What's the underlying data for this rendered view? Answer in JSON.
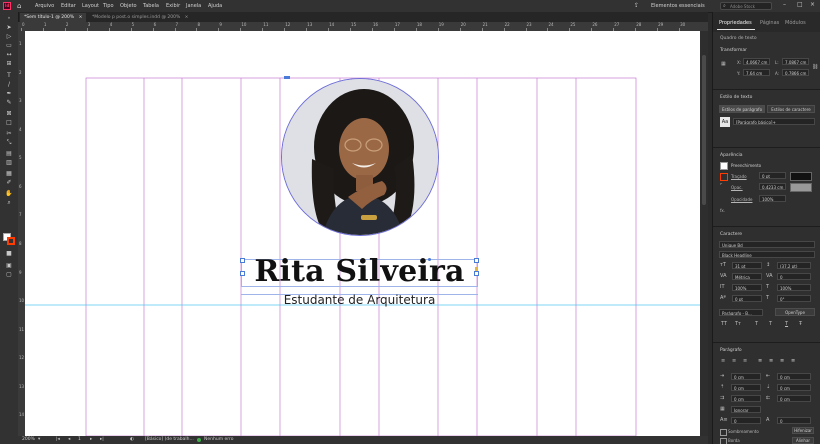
{
  "app": {
    "logo": "Id",
    "home_icon": "home-icon"
  },
  "menu": {
    "items": [
      "Arquivo",
      "Editar",
      "Layout",
      "Tipo",
      "Objeto",
      "Tabela",
      "Exibir",
      "Janela",
      "Ajuda"
    ],
    "workspace": "Elementos essenciais",
    "search_placeholder": "Adobe Stock"
  },
  "tabs": [
    {
      "label": "*Sem título-1 @ 200%",
      "active": true
    },
    {
      "label": "*Modelo p post.o simples.indd @ 200%",
      "active": false
    }
  ],
  "ruler": {
    "h_ticks": [
      "0",
      "1",
      "2",
      "3",
      "4",
      "5",
      "6",
      "7",
      "8",
      "9",
      "10",
      "11",
      "12",
      "13",
      "14",
      "15",
      "16",
      "17",
      "18",
      "19",
      "20",
      "21",
      "22",
      "23",
      "24",
      "25",
      "26",
      "27",
      "28",
      "29",
      "30"
    ],
    "v_ticks": [
      "1",
      "2",
      "3",
      "4",
      "5",
      "6",
      "7",
      "8",
      "9",
      "10",
      "11",
      "12",
      "13",
      "14"
    ]
  },
  "canvas": {
    "name": "Rita Silveira",
    "subtitle": "Estudante de Arquitetura",
    "photo_alt": "retrato circular"
  },
  "status": {
    "zoom": "200%",
    "page": "1",
    "style": "[Básico] (de trabalh...",
    "preflight": "Nenhum erro"
  },
  "panel": {
    "tabs": [
      "Propriedades",
      "Páginas",
      "Módulos"
    ],
    "frame_type": "Quadro de texto",
    "transform": {
      "title": "Transformar",
      "x_label": "X:",
      "x": "4,0667 cm",
      "y_label": "Y:",
      "y": "7,64 cm",
      "w_label": "L:",
      "w": "7,0867 cm",
      "h_label": "A:",
      "h": "0,7866 cm"
    },
    "text_style": {
      "title": "Estilo de texto",
      "para_btn": "Estilos de parágrafo",
      "char_btn": "Estilos de caractere",
      "preview": "Aa",
      "style_value": "[Parágrafo básico]+"
    },
    "appearance": {
      "title": "Aparência",
      "fill": "Preenchimento",
      "stroke": "Traçado",
      "stroke_value": "0 pt",
      "opacity_label": "Opac.",
      "opacity_value": "0,4233 cm",
      "transparency_label": "Opacidade",
      "transparency_value": "100%",
      "fx": "fx."
    },
    "character": {
      "title": "Caractere",
      "font": "Unique Bd",
      "font_style": "Black Headline",
      "size": "31 pt",
      "leading": "(37,2 pt)",
      "kerning": "Métrica",
      "tracking": "0",
      "vscale": "100%",
      "hscale": "100%",
      "baseline": "0 pt",
      "skew": "0°",
      "para_style": "Parágrafo - B...",
      "opentype": "OpenType",
      "caps": [
        "TT",
        "Tт",
        "T",
        "T",
        "T",
        "Ŧ"
      ]
    },
    "paragraph": {
      "title": "Parágrafo",
      "left_indent": "0 cm",
      "right_indent": "0 cm",
      "space_before": "0 cm",
      "space_after": "0 cm",
      "first_line": "0 cm",
      "last_line": "0 cm",
      "hyphen": "Ignorar",
      "drop_lines": "0",
      "drop_chars": "0",
      "hyphenate": "Hifenizar",
      "hyphenate_btn": "Hifenizar",
      "align_to_grid": "Alinhar",
      "shading": "Sombreamento",
      "border": "Borda"
    }
  },
  "colors": {
    "guide_column": "#c77bd6",
    "guide_horizontal": "#52c6ef",
    "accent": "#ff3d00",
    "selection": "#4a7bd8",
    "app_bg": "#2b2b2b"
  }
}
